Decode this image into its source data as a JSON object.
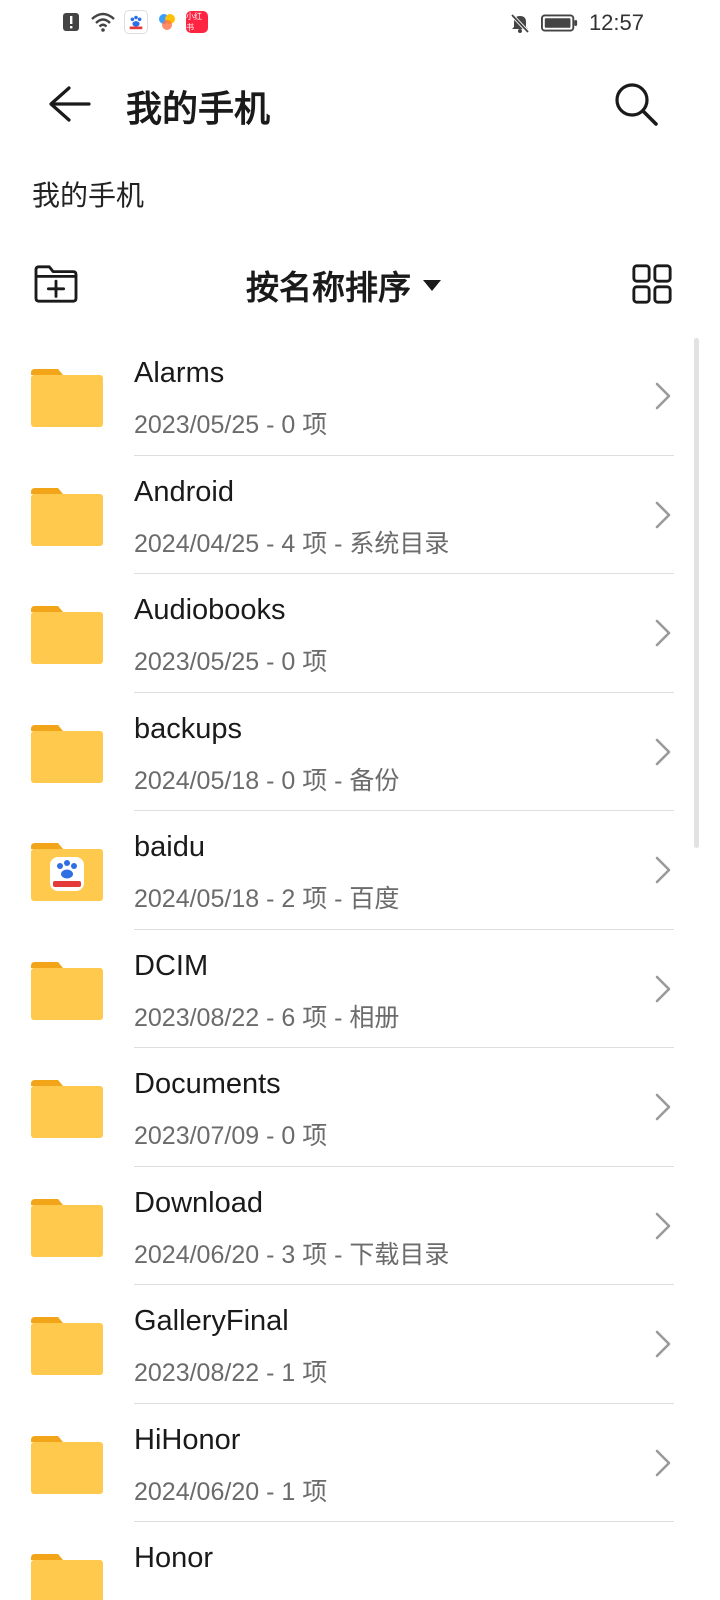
{
  "status_bar": {
    "time": "12:57",
    "icons": [
      "alert-icon",
      "wifi-icon",
      "baidu-app-icon",
      "pinwheel-app-icon",
      "app-badge-icon",
      "bell-muted-icon",
      "battery-icon"
    ],
    "app_badge_text": "小红书"
  },
  "header": {
    "title": "我的手机",
    "back_icon": "arrow-left-icon",
    "search_icon": "search-icon"
  },
  "breadcrumb": "我的手机",
  "toolbar": {
    "new_folder_icon": "new-folder-icon",
    "sort_label": "按名称排序",
    "view_icon": "grid-view-icon"
  },
  "files": [
    {
      "name": "Alarms",
      "meta": "2023/05/25 - 0 项"
    },
    {
      "name": "Android",
      "meta": "2024/04/25 - 4 项 - 系统目录"
    },
    {
      "name": "Audiobooks",
      "meta": "2023/05/25 - 0 项"
    },
    {
      "name": "backups",
      "meta": "2024/05/18 - 0 项 - 备份"
    },
    {
      "name": "baidu",
      "meta": "2024/05/18 - 2 项 - 百度",
      "badge": "百度"
    },
    {
      "name": "DCIM",
      "meta": "2023/08/22 - 6 项 - 相册"
    },
    {
      "name": "Documents",
      "meta": "2023/07/09 - 0 项"
    },
    {
      "name": "Download",
      "meta": "2024/06/20 - 3 项 - 下载目录"
    },
    {
      "name": "GalleryFinal",
      "meta": "2023/08/22 - 1 项"
    },
    {
      "name": "HiHonor",
      "meta": "2024/06/20 - 1 项"
    },
    {
      "name": "Honor",
      "meta": ""
    }
  ],
  "colors": {
    "folder": "#FFC94D",
    "folder_tab": "#F3A51A",
    "secondary_text": "#6b6b6b"
  }
}
